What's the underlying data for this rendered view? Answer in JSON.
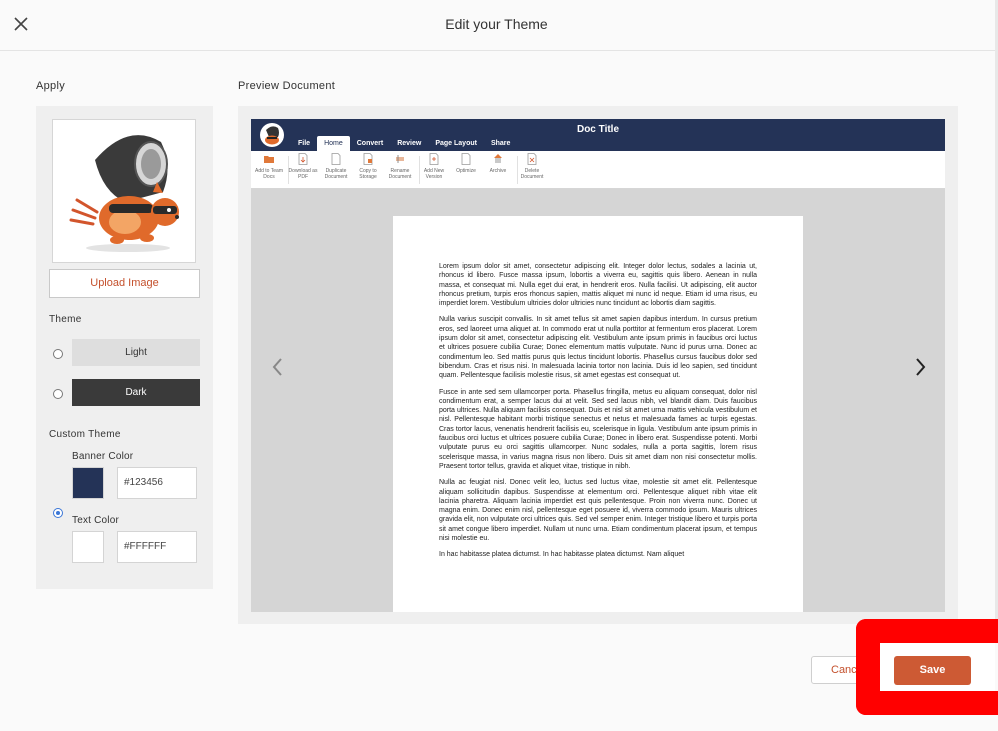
{
  "header": {
    "title": "Edit your Theme",
    "close_icon": "close-icon"
  },
  "apply": {
    "label": "Apply",
    "upload_label": "Upload Image",
    "theme_label": "Theme",
    "themes": [
      {
        "label": "Light",
        "selected": false
      },
      {
        "label": "Dark",
        "selected": false
      }
    ],
    "custom_theme": {
      "label": "Custom Theme",
      "selected": true,
      "banner_color": {
        "label": "Banner Color",
        "value": "#123456",
        "swatch": "#243357"
      },
      "text_color": {
        "label": "Text Color",
        "value": "#FFFFFF",
        "swatch": "#ffffff"
      }
    }
  },
  "preview": {
    "label": "Preview Document",
    "doc_title": "Doc Title",
    "menu": [
      {
        "label": "File",
        "active": false
      },
      {
        "label": "Home",
        "active": true
      },
      {
        "label": "Convert",
        "active": false
      },
      {
        "label": "Review",
        "active": false
      },
      {
        "label": "Page Layout",
        "active": false
      },
      {
        "label": "Share",
        "active": false
      }
    ],
    "ribbon": [
      {
        "label": "Add to Team Docs",
        "icon": "folder-icon"
      },
      {
        "label": "Download as PDF",
        "icon": "download-icon"
      },
      {
        "label": "Duplicate Document",
        "icon": "duplicate-icon"
      },
      {
        "label": "Copy to Storage",
        "icon": "copy-icon"
      },
      {
        "label": "Rename Document",
        "icon": "rename-icon"
      },
      {
        "label": "Add New Version",
        "icon": "add-version-icon"
      },
      {
        "label": "Optimize",
        "icon": "optimize-icon"
      },
      {
        "label": "Archive",
        "icon": "archive-icon"
      },
      {
        "label": "Delete Document",
        "icon": "delete-icon"
      }
    ],
    "paragraphs": [
      "Lorem ipsum dolor sit amet, consectetur adipiscing elit. Integer dolor lectus, sodales a lacinia ut, rhoncus id libero. Fusce massa ipsum, lobortis a viverra eu, sagittis quis libero. Aenean in nulla massa, et consequat mi. Nulla eget dui erat, in hendrerit eros. Nulla facilisi. Ut adipiscing, elit auctor rhoncus pretium, turpis eros rhoncus sapien, mattis aliquet mi nunc id neque. Etiam id urna risus, eu imperdiet lorem. Vestibulum ultricies dolor ultricies nunc tincidunt ac lobortis diam sagittis.",
      "Nulla varius suscipit convallis. In sit amet tellus sit amet sapien dapibus interdum. In cursus pretium eros, sed laoreet urna aliquet at. In commodo erat ut nulla porttitor at fermentum eros placerat. Lorem ipsum dolor sit amet, consectetur adipiscing elit. Vestibulum ante ipsum primis in faucibus orci luctus et ultrices posuere cubilia Curae; Donec elementum mattis vulputate. Nunc id purus urna. Donec ac condimentum leo. Sed mattis purus quis lectus tincidunt lobortis. Phasellus cursus faucibus dolor sed bibendum. Cras et risus nisi. In malesuada lacinia tortor non lacinia. Duis id leo sapien, sed tincidunt quam. Pellentesque facilisis molestie risus, sit amet egestas est consequat ut.",
      "Fusce in ante sed sem ullamcorper porta. Phasellus fringilla, metus eu aliquam consequat, dolor nisl condimentum erat, a semper lacus dui at velit. Sed sed lacus nibh, vel blandit diam. Duis faucibus porta ultrices. Nulla aliquam facilisis consequat. Duis et nisl sit amet urna mattis vehicula vestibulum et nisl. Pellentesque habitant morbi tristique senectus et netus et malesuada fames ac turpis egestas. Cras tortor lacus, venenatis hendrerit facilisis eu, scelerisque in ligula. Vestibulum ante ipsum primis in faucibus orci luctus et ultrices posuere cubilia Curae; Donec in libero erat. Suspendisse potenti. Morbi vulputate purus eu orci sagittis ullamcorper. Nunc sodales, nulla a porta sagittis, lorem risus scelerisque massa, in varius magna risus non libero. Duis sit amet diam non nisi consectetur mollis. Praesent tortor tellus, gravida et aliquet vitae, tristique in nibh.",
      "Nulla ac feugiat nisl. Donec velit leo, luctus sed luctus vitae, molestie sit amet elit. Pellentesque aliquam sollicitudin dapibus. Suspendisse at elementum orci. Pellentesque aliquet nibh vitae elit lacinia pharetra. Aliquam lacinia imperdiet est quis pellentesque. Proin non viverra nunc. Donec ut magna enim. Donec enim nisl, pellentesque eget posuere id, viverra commodo ipsum. Mauris ultrices gravida elit, non vulputate orci ultrices quis. Sed vel semper enim. Integer tristique libero et turpis porta sit amet congue libero imperdiet. Nullam ut nunc urna. Etiam condimentum placerat ipsum, et tempus nisi molestie eu.",
      "In hac habitasse platea dictumst. In hac habitasse platea dictumst. Nam aliquet"
    ]
  },
  "footer": {
    "cancel_label": "Cancel",
    "save_label": "Save"
  },
  "colors": {
    "accent": "#cd5a34",
    "banner": "#243357",
    "highlight": "#ff0000"
  }
}
